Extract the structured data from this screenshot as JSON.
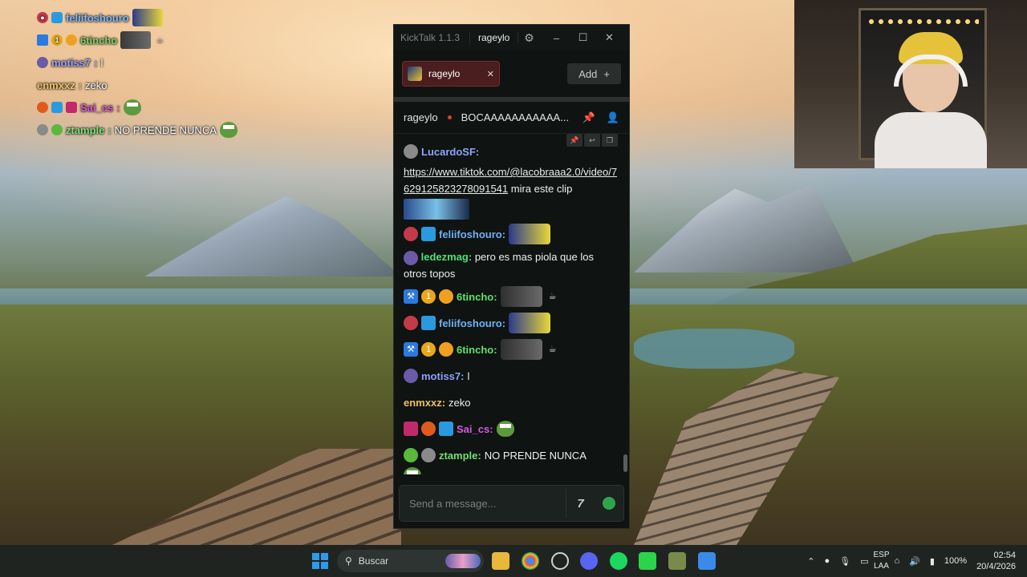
{
  "desktop_overlay": [
    {
      "user": "feliifoshouro",
      "user_color": "#7fb8ff",
      "msg": ""
    },
    {
      "user": "6tincho",
      "user_color": "#7fd36b",
      "msg": ""
    },
    {
      "user": "motiss7",
      "user_color": "#9aa0ff",
      "msg": "l"
    },
    {
      "user": "enmxxz",
      "user_color": "#f1c36a",
      "msg": "zeko"
    },
    {
      "user": "Sai_cs",
      "user_color": "#e05ad8",
      "msg": ""
    },
    {
      "user": "ztample",
      "user_color": "#7fe07a",
      "msg": "NO PRENDE NUNCA"
    }
  ],
  "kicktalk": {
    "app_title": "KickTalk 1.1.3",
    "account": "rageylo",
    "tab_label": "rageylo",
    "add_label": "Add",
    "add_icon": "+",
    "channel_name": "rageylo",
    "stream_title": "BOCAAAAAAAAAAA...",
    "messages": [
      {
        "user": "LucardoSF:",
        "color": "#8ea4ff",
        "link": "https://www.tiktok.com/@lacobraaa2.0/video/7629125823278091541",
        "text": " mira este clip"
      },
      {
        "user": "feliifoshouro:",
        "color": "#6eb2f5",
        "text": ""
      },
      {
        "user": "ledezmag:",
        "color": "#4ee07a",
        "text": " pero es mas piola que los otros topos"
      },
      {
        "user": "6tincho:",
        "color": "#5ee06a",
        "text": ""
      },
      {
        "user": "feliifoshouro:",
        "color": "#6eb2f5",
        "text": ""
      },
      {
        "user": "6tincho:",
        "color": "#5ee06a",
        "text": ""
      },
      {
        "user": "motiss7:",
        "color": "#8ea0ff",
        "text": " l"
      },
      {
        "user": "enmxxz:",
        "color": "#f0c060",
        "text": " zeko"
      },
      {
        "user": "Sai_cs:",
        "color": "#d35ae0",
        "text": ""
      },
      {
        "user": "ztample:",
        "color": "#72e072",
        "text": " NO PRENDE NUNCA"
      }
    ],
    "input_placeholder": "Send a message..."
  },
  "taskbar": {
    "search_label": "Buscar",
    "lang_top": "ESP",
    "lang_bottom": "LAA",
    "battery": "100%",
    "time": "02:54",
    "date": "20/4/2026"
  }
}
